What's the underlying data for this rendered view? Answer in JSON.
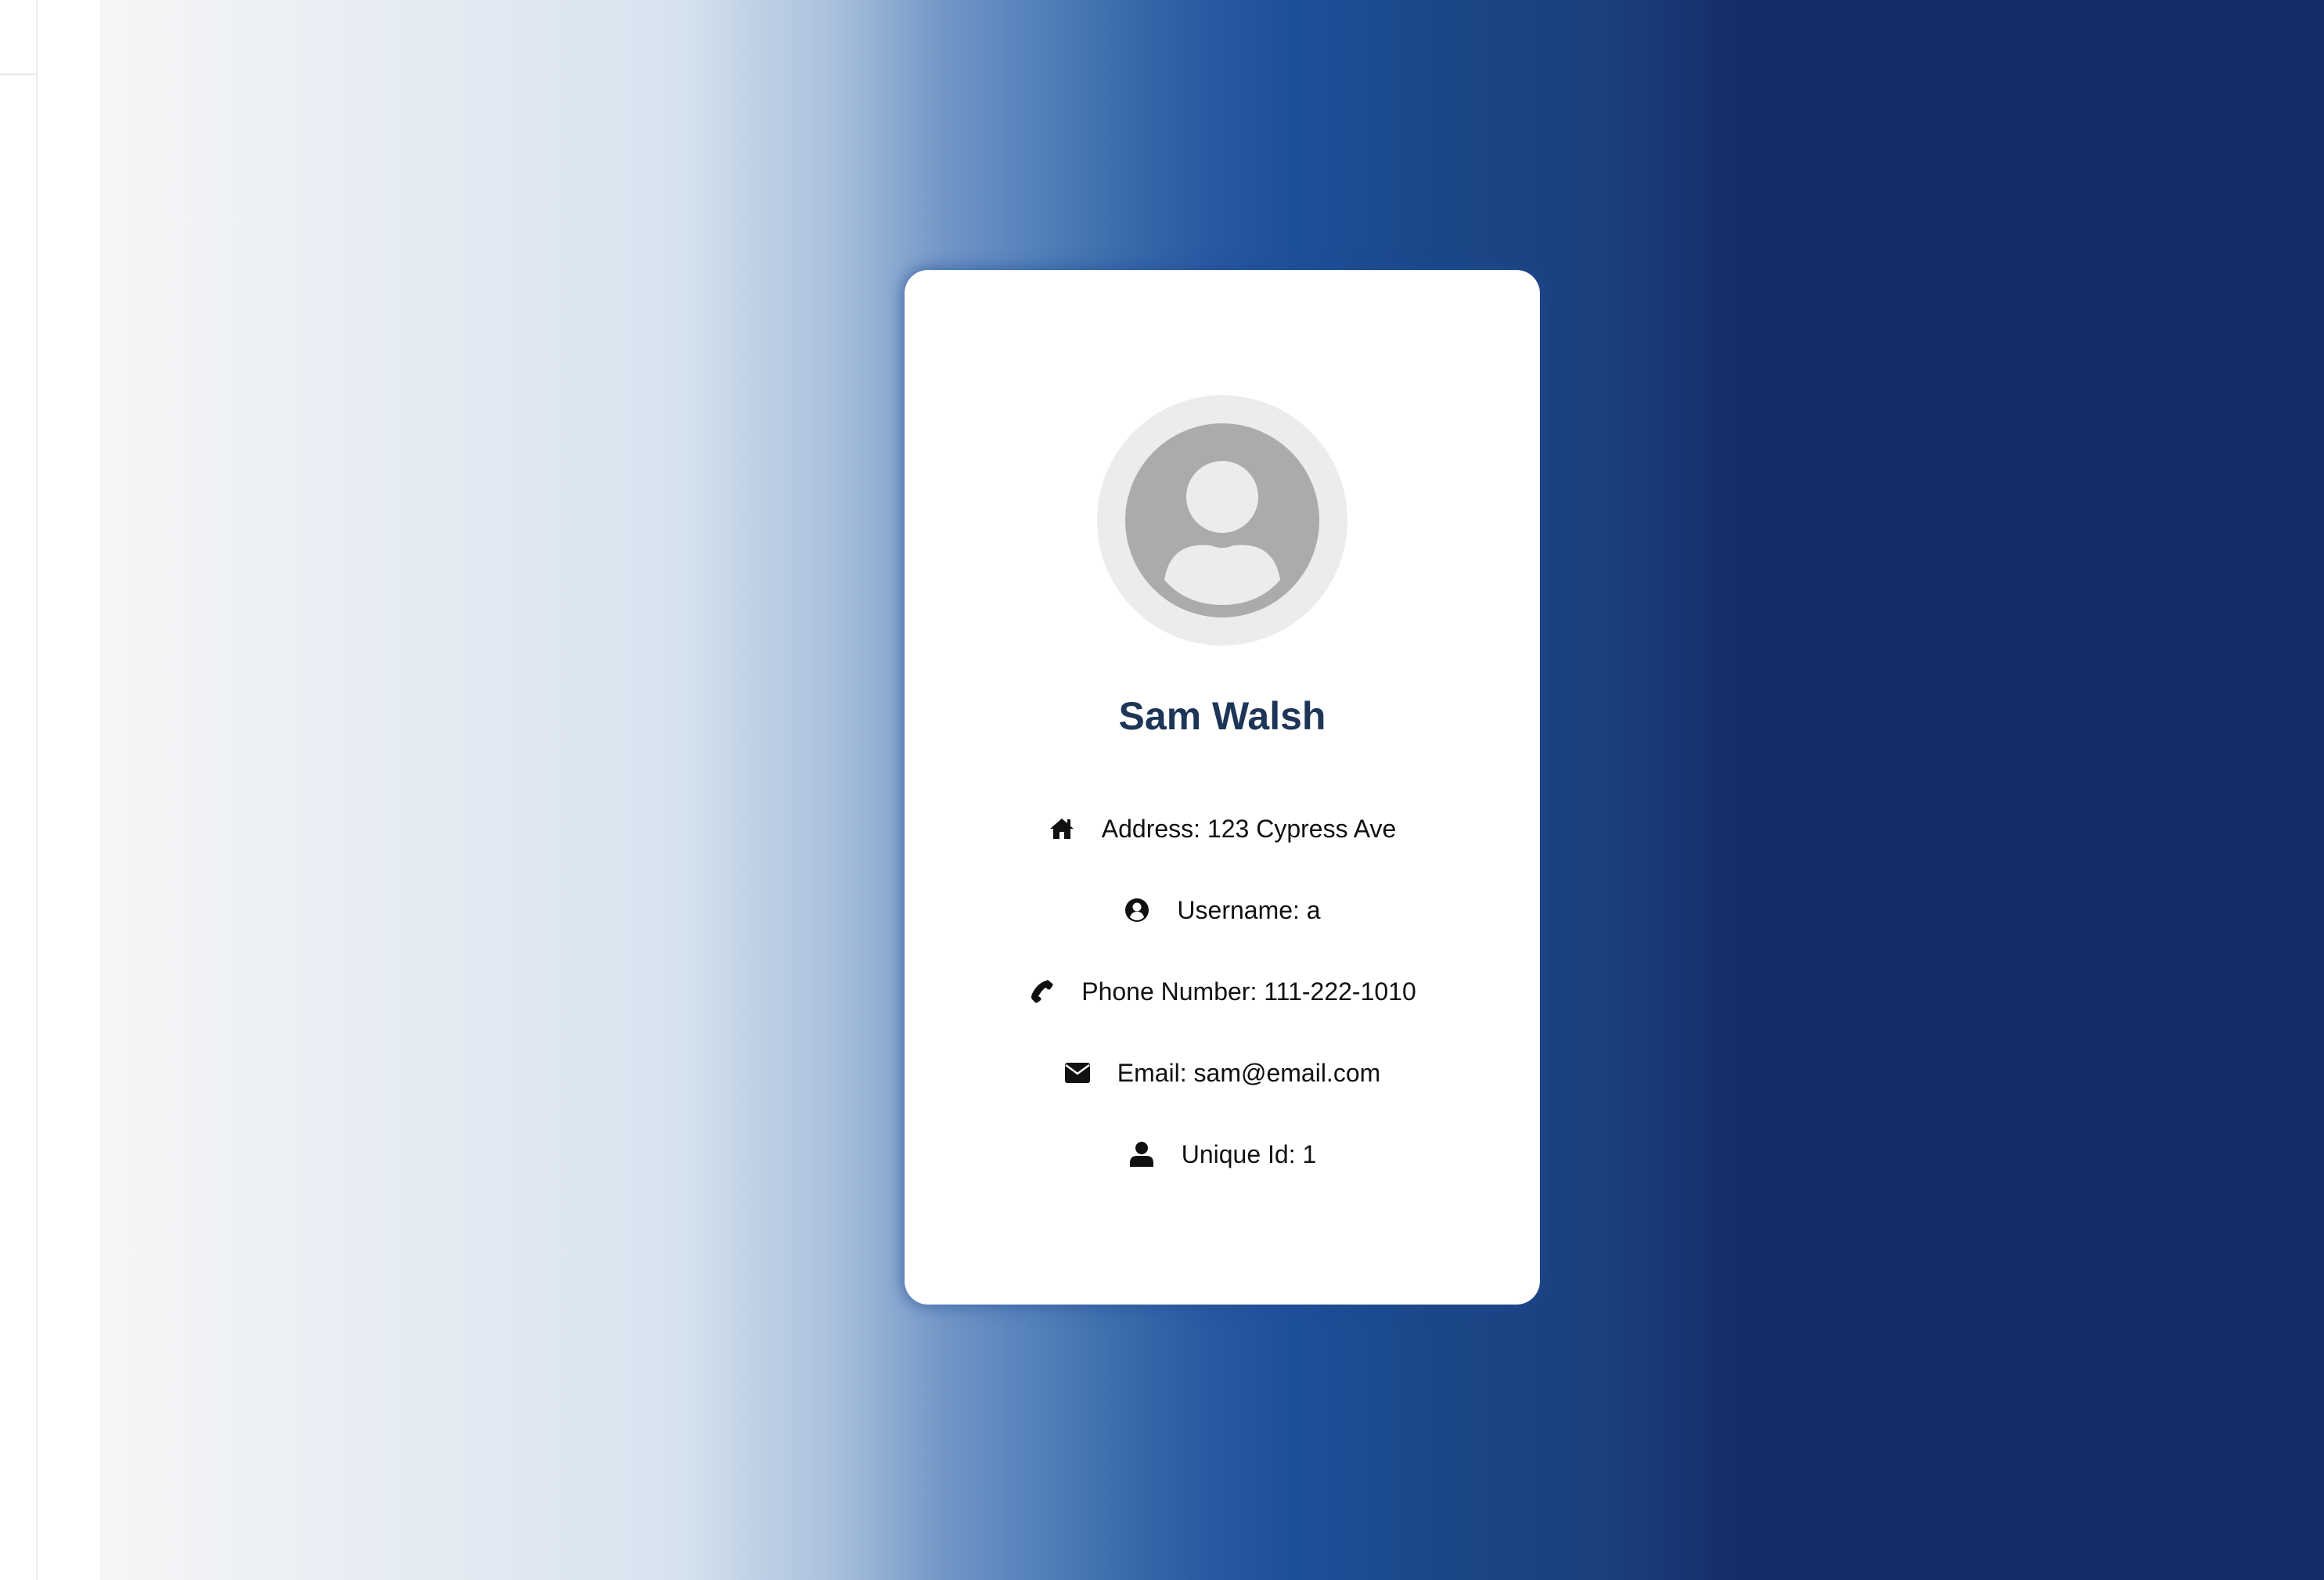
{
  "profile": {
    "name": "Sam Walsh",
    "avatar_icon": "user-circle-icon",
    "fields": [
      {
        "icon": "home-icon",
        "text": "Address: 123 Cypress Ave"
      },
      {
        "icon": "user-circle-icon",
        "text": "Username: a"
      },
      {
        "icon": "phone-icon",
        "text": "Phone Number: 111-222-1010"
      },
      {
        "icon": "envelope-icon",
        "text": "Email: sam@email.com"
      },
      {
        "icon": "user-icon",
        "text": "Unique Id: 1"
      }
    ]
  },
  "colors": {
    "name_text": "#1d3557",
    "card_background": "#ffffff",
    "gradient_start": "#f6f6f6",
    "gradient_mid": "#d6e3ef",
    "gradient_blue": "#1d4f98",
    "gradient_end": "#152c68",
    "avatar_gray": "#ababab",
    "avatar_ring": "#ececec"
  }
}
